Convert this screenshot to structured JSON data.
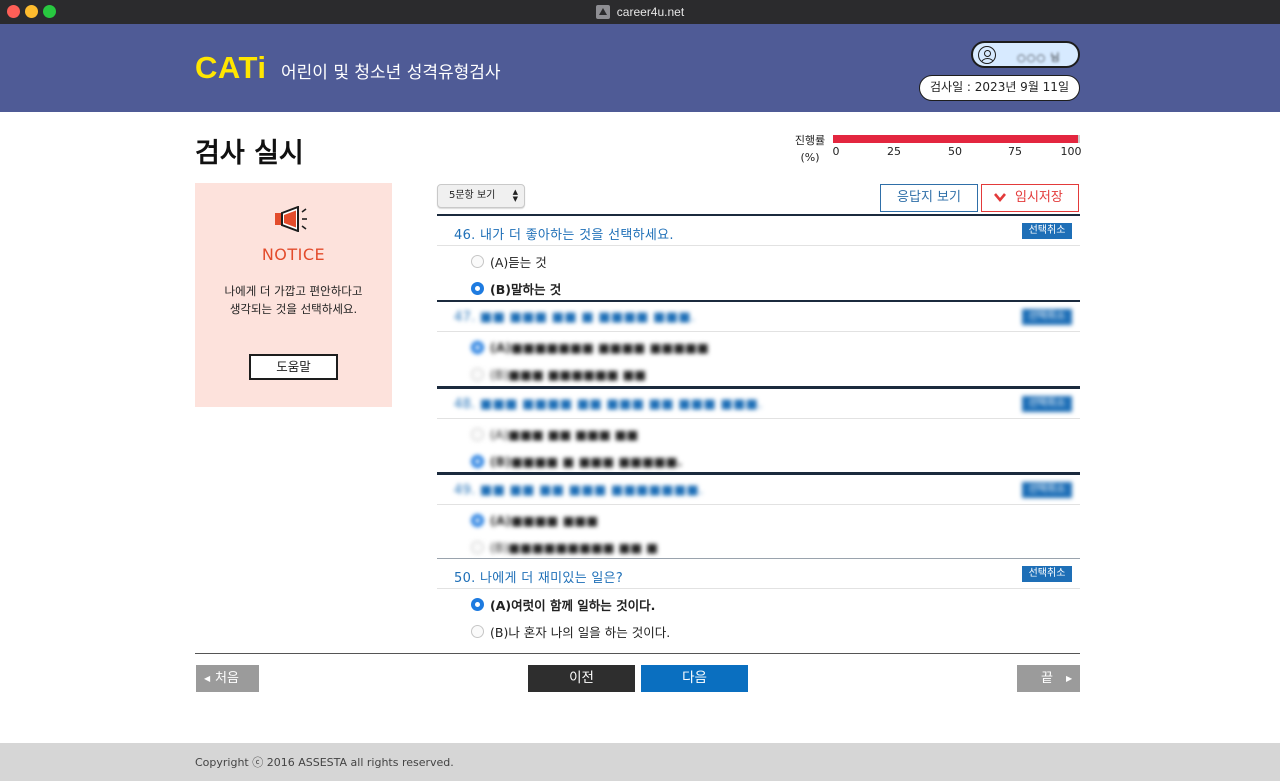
{
  "browser": {
    "url": "career4u.net"
  },
  "header": {
    "logo": "CATi",
    "subtitle": "어린이 및 청소년 성격유형검사",
    "user_name": "○○○ 님",
    "test_date": "검사일 : 2023년 9월 11일"
  },
  "page": {
    "title": "검사 실시",
    "progress_label_line1": "진행률",
    "progress_label_line2": "(%)",
    "progress_percent": 99,
    "progress_ticks": [
      "0",
      "25",
      "50",
      "75",
      "100"
    ]
  },
  "notice": {
    "title": "NOTICE",
    "line1": "나에게 더 가깝고 편안하다고",
    "line2": "생각되는 것을 선택하세요.",
    "help_button": "도움말"
  },
  "toolbar": {
    "view_select": "5문항 보기",
    "answer_sheet_button": "응답지 보기",
    "temp_save_button": "임시저장"
  },
  "questions": [
    {
      "title": "46. 내가 더 좋아하는 것을 선택하세요.",
      "cancel": "선택취소",
      "option_a": "(A)듣는 것",
      "option_b": "(B)말하는 것",
      "selected": "B",
      "blurred": false
    },
    {
      "title": "47. ■■ ■■■ ■■ ■ ■■■■ ■■■.",
      "cancel": "선택취소",
      "option_a": "(A)■■■■■■■ ■■■■ ■■■■■",
      "option_b": "(B)■■■ ■■■■■■ ■■",
      "selected": "A",
      "blurred": true
    },
    {
      "title": "48. ■■■ ■■■■ ■■ ■■■ ■■ ■■■ ■■■.",
      "cancel": "선택취소",
      "option_a": "(A)■■■ ■■ ■■■ ■■",
      "option_b": "(B)■■■■ ■ ■■■ ■■■■■.",
      "selected": "B",
      "blurred": true
    },
    {
      "title": "49. ■■ ■■ ■■ ■■■ ■■■■■■■.",
      "cancel": "선택취소",
      "option_a": "(A)■■■■ ■■■",
      "option_b": "(B)■■■■■■■■■ ■■ ■",
      "selected": "A",
      "blurred": true
    },
    {
      "title": "50. 나에게 더 재미있는 일은?",
      "cancel": "선택취소",
      "option_a": "(A)여럿이 함께 일하는 것이다.",
      "option_b": "(B)나 혼자 나의 일을 하는 것이다.",
      "selected": "A",
      "blurred": false
    }
  ],
  "nav": {
    "first": "처음",
    "prev": "이전",
    "next": "다음",
    "last": "끝"
  },
  "footer": {
    "copyright": "Copyright ⓒ 2016 ASSESTA all rights reserved."
  },
  "colors": {
    "header_bg": "#4f5b96",
    "logo": "#ffe600",
    "accent_blue": "#1e6fb7",
    "progress": "#e3263f",
    "notice_bg": "#fde2dc",
    "notice_title": "#e34c2c"
  }
}
